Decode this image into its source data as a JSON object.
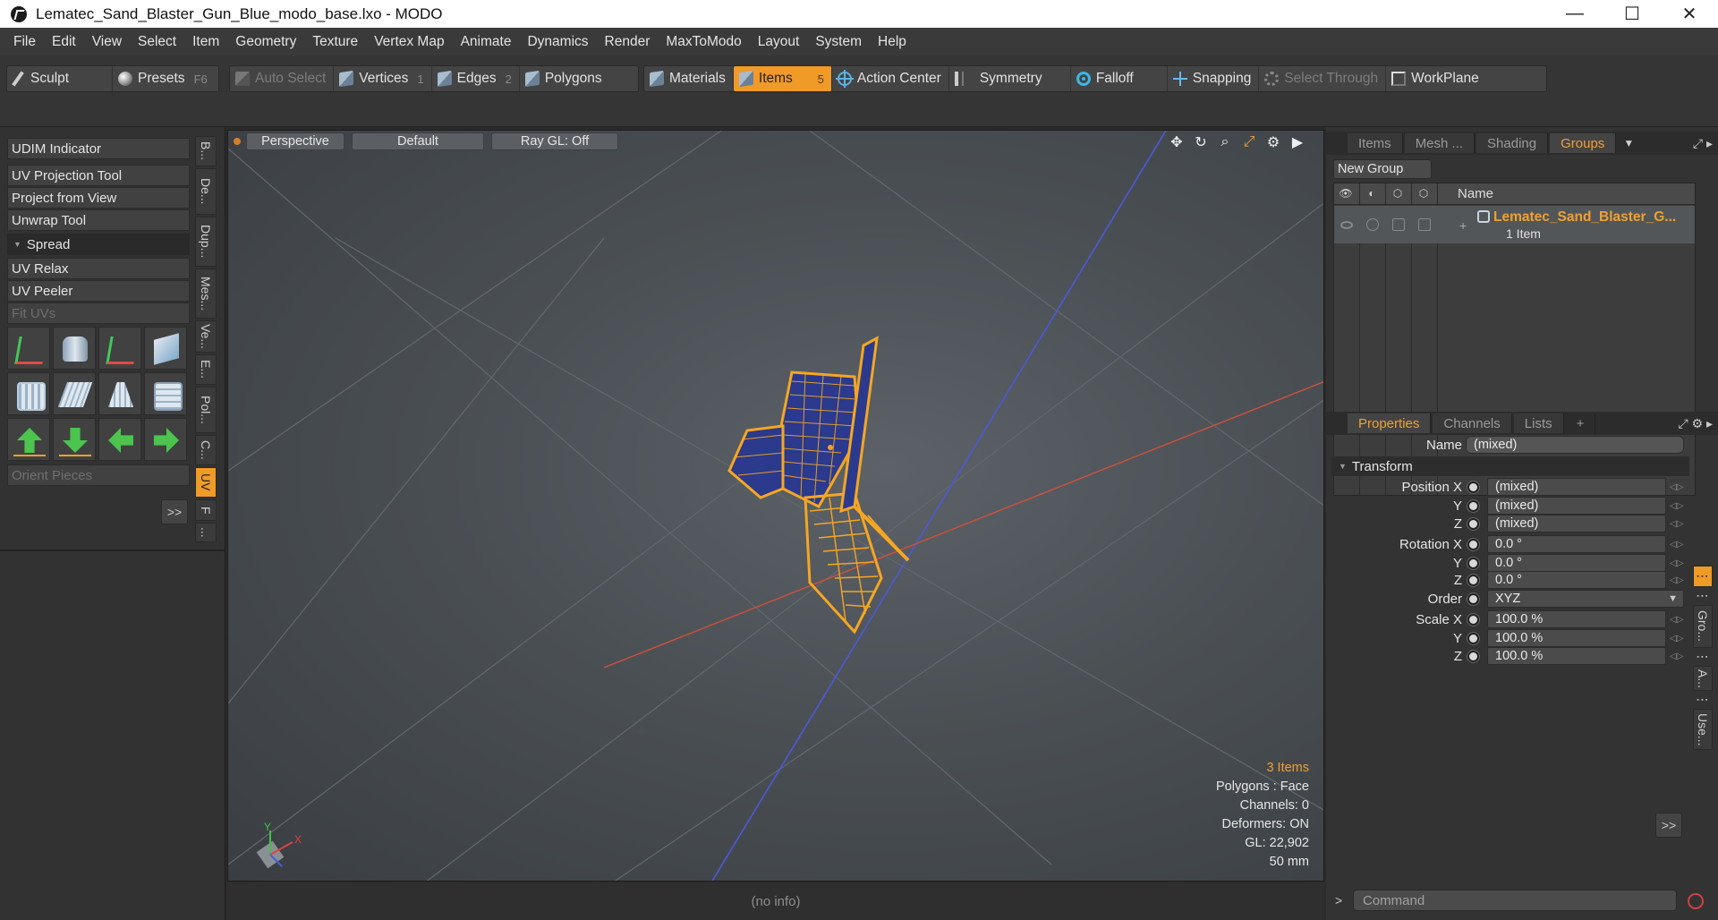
{
  "window": {
    "title": "Lematec_Sand_Blaster_Gun_Blue_modo_base.lxo - MODO",
    "controls": {
      "minimize": "—",
      "maximize": "☐",
      "close": "✕"
    }
  },
  "menu": [
    "File",
    "Edit",
    "View",
    "Select",
    "Item",
    "Geometry",
    "Texture",
    "Vertex Map",
    "Animate",
    "Dynamics",
    "Render",
    "MaxToModo",
    "Layout",
    "System",
    "Help"
  ],
  "toolbar": {
    "sculpt": "Sculpt",
    "presets": "Presets",
    "presets_key": "F6",
    "auto_select": "Auto Select",
    "vertices": "Vertices",
    "vertices_key": "1",
    "edges": "Edges",
    "edges_key": "2",
    "polygons": "Polygons",
    "materials": "Materials",
    "items": "Items",
    "items_key": "5",
    "action_center": "Action Center",
    "symmetry": "Symmetry",
    "falloff": "Falloff",
    "snapping": "Snapping",
    "select_through": "Select Through",
    "workplane": "WorkPlane"
  },
  "tools": {
    "udim": "UDIM Indicator",
    "uv_projection": "UV Projection Tool",
    "project_from_view": "Project from View",
    "unwrap": "Unwrap Tool",
    "spread": "Spread",
    "uv_relax": "UV Relax",
    "uv_peeler": "UV Peeler",
    "fit_uvs": "Fit UVs",
    "orient_pieces": "Orient Pieces",
    "more": ">>"
  },
  "left_tabs": [
    "B...",
    "De...",
    "Dup...",
    "Mes...",
    "Ve...",
    "E...",
    "Pol...",
    "C...",
    "UV",
    "F",
    "..."
  ],
  "viewport": {
    "view": "Perspective",
    "shading": "Default",
    "raygl": "Ray GL: Off",
    "stats": {
      "items": "3 Items",
      "polygons": "Polygons : Face",
      "channels": "Channels: 0",
      "deformers": "Deformers: ON",
      "gl": "GL: 22,902",
      "distance": "50 mm"
    },
    "axis_x": "X",
    "axis_y": "Y"
  },
  "status": "(no info)",
  "groups_panel": {
    "tabs": [
      "Items",
      "Mesh ...",
      "Shading",
      "Groups"
    ],
    "active_tab": "Groups",
    "new_group": "New Group",
    "name_header": "Name",
    "row": {
      "name": "Lematec_Sand_Blaster_G...",
      "sub": "1 Item"
    }
  },
  "properties_panel": {
    "tabs": [
      "Properties",
      "Channels",
      "Lists",
      "+"
    ],
    "name_label": "Name",
    "name_value": "(mixed)",
    "transform": "Transform",
    "position_x_label": "Position X",
    "position_x": "(mixed)",
    "position_y": "(mixed)",
    "position_z": "(mixed)",
    "rotation_x_label": "Rotation X",
    "rotation_x": "0.0 °",
    "rotation_y": "0.0 °",
    "rotation_z": "0.0 °",
    "order_label": "Order",
    "order": "XYZ",
    "scale_x_label": "Scale X",
    "scale_x": "100.0 %",
    "scale_y": "100.0 %",
    "scale_z": "100.0 %",
    "y_label": "Y",
    "z_label": "Z",
    "more": ">>"
  },
  "right_tabs": [
    "Gro...",
    "A...",
    "Use..."
  ],
  "command": {
    "placeholder": "Command"
  },
  "colors": {
    "accent": "#f09a28",
    "mesh": "#f5a623",
    "mesh_fill": "#2b3a8c",
    "axis_red": "#d0503c",
    "axis_blue": "#4a5ad8"
  }
}
